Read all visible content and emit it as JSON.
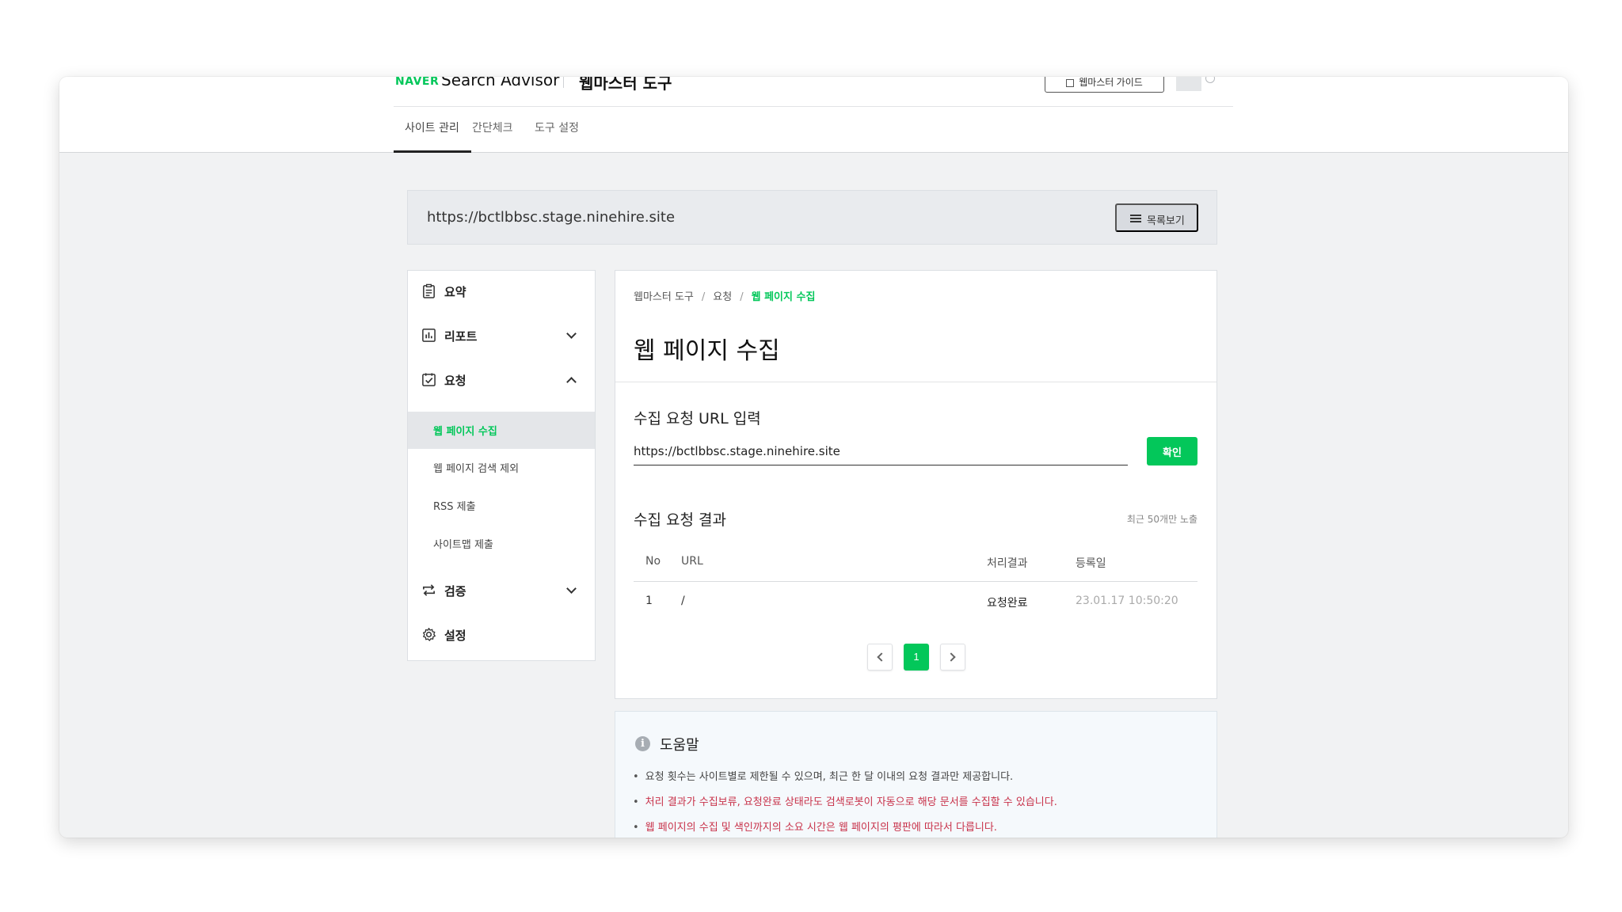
{
  "header": {
    "logo_brand": "NAVER",
    "logo_product": "Search Advisor",
    "logo_tool": "웹마스터 도구",
    "guide_button": "웹마스터 가이드",
    "tabs": [
      {
        "label": "사이트 관리",
        "active": true
      },
      {
        "label": "간단체크",
        "active": false
      },
      {
        "label": "도구 설정",
        "active": false
      }
    ]
  },
  "site_bar": {
    "url": "https://bctlbbsc.stage.ninehire.site",
    "list_button": "목록보기"
  },
  "sidebar": {
    "items": [
      {
        "label": "요약",
        "icon": "clipboard-icon"
      },
      {
        "label": "리포트",
        "icon": "chart-icon",
        "expanded": false
      },
      {
        "label": "요청",
        "icon": "checklist-icon",
        "expanded": true
      },
      {
        "label": "검증",
        "icon": "repeat-icon",
        "expanded": false
      },
      {
        "label": "설정",
        "icon": "gear-icon"
      }
    ],
    "sub_items": [
      {
        "label": "웹 페이지 수집",
        "active": true
      },
      {
        "label": "웹 페이지 검색 제외",
        "active": false
      },
      {
        "label": "RSS 제출",
        "active": false
      },
      {
        "label": "사이트맵 제출",
        "active": false
      }
    ]
  },
  "main": {
    "breadcrumb": [
      "웹마스터 도구",
      "요청",
      "웹 페이지 수집"
    ],
    "breadcrumb_sep": "/",
    "title": "웹 페이지 수집",
    "input_section_title": "수집 요청 URL 입력",
    "url_input_value": "https://bctlbbsc.stage.ninehire.site",
    "confirm_button": "확인",
    "result_section_title": "수집 요청 결과",
    "result_note": "최근 50개만 노출",
    "table": {
      "headers": [
        "No",
        "URL",
        "처리결과",
        "등록일"
      ],
      "rows": [
        {
          "no": "1",
          "url": "/",
          "result": "요청완료",
          "date": "23.01.17 10:50:20"
        }
      ]
    },
    "pagination": {
      "current": "1"
    }
  },
  "help": {
    "title": "도움말",
    "icon_glyph": "i",
    "items": [
      {
        "text": "요청 횟수는 사이트별로 제한될 수 있으며, 최근 한 달 이내의 요청 결과만 제공합니다.",
        "style": "plain"
      },
      {
        "text": "처리 결과가 수집보류, 요청완료 상태라도 검색로봇이 자동으로 해당 문서를 수집할 수 있습니다.",
        "style": "warn"
      },
      {
        "text": "웹 페이지의 수집 및 색인까지의 소요 시간은 웹 페이지의 평판에 따라서 다릅니다.",
        "style": "warn"
      }
    ]
  },
  "colors": {
    "accent_green": "#03c75a",
    "warning_red": "#c8324a"
  }
}
